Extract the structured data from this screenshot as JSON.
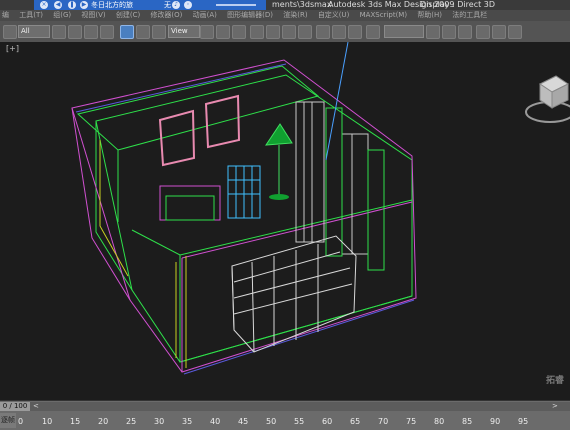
{
  "titlebar": {
    "seg1": "ments\\3dsmax",
    "seg2": "Autodesk 3ds Max Design 2009",
    "seg3": "Display : Direct 3D"
  },
  "player": {
    "track": "冬日北方的旅",
    "side_label": "无"
  },
  "menu": {
    "items": [
      "编",
      "工具(T)",
      "组(G)",
      "视图(V)",
      "创建(C)",
      "修改器(O)",
      "动画(A)",
      "图形编辑器(D)",
      "渲染(R)",
      "自定义(U)",
      "MAXScript(M)",
      "帮助(H)",
      "法的工具栏"
    ]
  },
  "toolbar": {
    "selection_filter": "All",
    "reference_coord": "View"
  },
  "viewport": {
    "label": "[+]"
  },
  "timeline": {
    "position": "0 / 100",
    "ticks": [
      "0",
      "10",
      "15",
      "20",
      "25",
      "30",
      "35",
      "40",
      "45",
      "50",
      "55",
      "60",
      "65",
      "70",
      "75",
      "80",
      "85",
      "90",
      "95"
    ],
    "corner_label": "逐帧"
  },
  "watermark": "拓睿",
  "colors": {
    "viewport_bg": "#1c1c1c",
    "wire_green": "#2ee04a",
    "wire_magenta": "#d050d0",
    "wire_yellow": "#c8d020",
    "wire_white": "#d8d8d8",
    "accent_blue": "#2a66c4"
  }
}
